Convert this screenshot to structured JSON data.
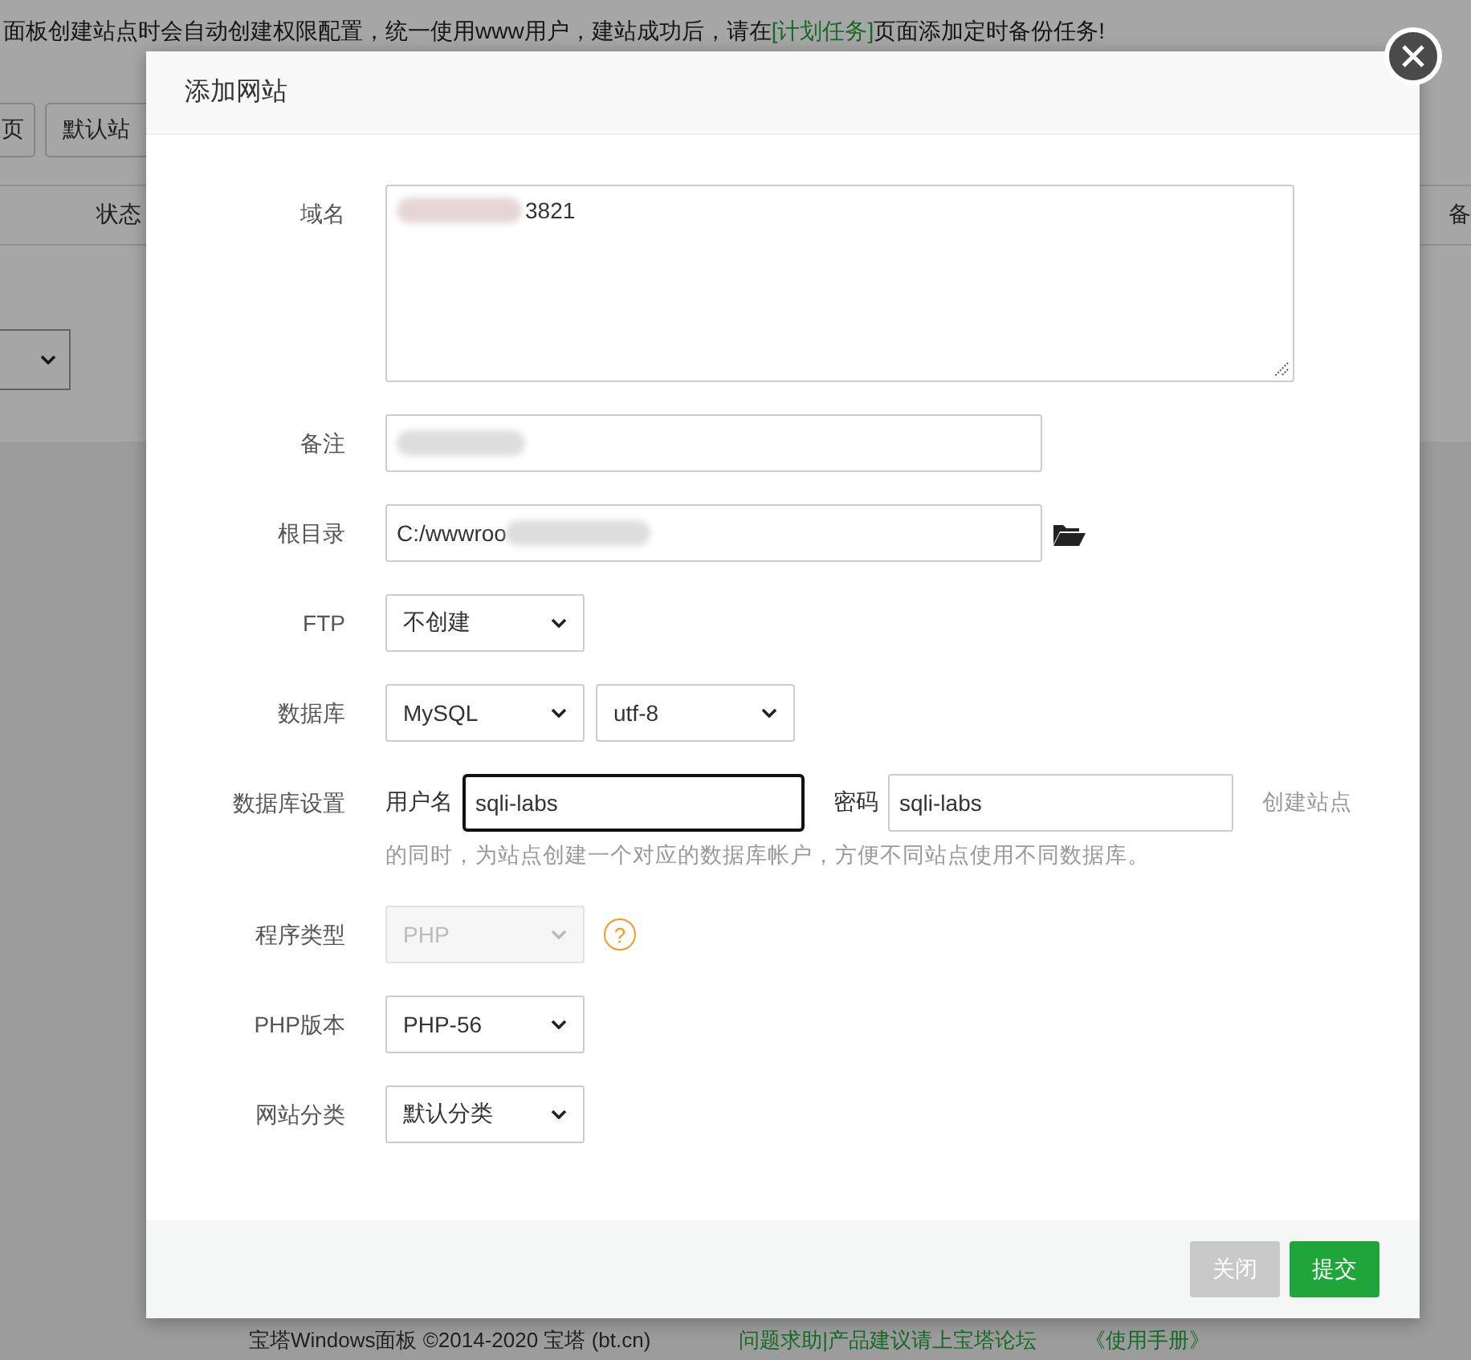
{
  "background": {
    "notice": {
      "text": "面板创建站点时会自动创建权限配置，统一使用www用户，建站成功后，请在",
      "link": "[计划任务]",
      "after": "页面添加定时备份任务!"
    },
    "buttons": [
      "页",
      "默认站"
    ],
    "table_header": [
      "状态",
      "备"
    ],
    "footer": {
      "copyright": "宝塔Windows面板 ©2014-2020 宝塔 (bt.cn)",
      "links": [
        "问题求助|产品建议请上宝塔论坛",
        "《使用手册》"
      ]
    }
  },
  "dialog": {
    "title": "添加网站",
    "fields": [
      {
        "kind": "textarea",
        "label": "域名",
        "value": "3821",
        "redacted": true
      },
      {
        "kind": "input",
        "label": "备注",
        "redacted": true
      },
      {
        "kind": "path",
        "label": "根目录",
        "value": "C:/wwwroo",
        "redacted": true
      },
      {
        "kind": "select",
        "label": "FTP",
        "selects": [
          {
            "value": "不创建",
            "disabled": false
          }
        ]
      },
      {
        "kind": "select",
        "label": "数据库",
        "selects": [
          {
            "value": "MySQL",
            "disabled": false
          },
          {
            "value": "utf-8",
            "disabled": false
          }
        ]
      },
      {
        "kind": "db",
        "label": "数据库设置",
        "user_label": "用户名",
        "user": "sqli-labs",
        "user_focused": true,
        "pass_label": "密码",
        "password": "sqli-labs",
        "hint_lines": [
          "创建站点",
          "的同时，为站点创建一个对应的数据库帐户，方便不同站点使用不同数据库。"
        ]
      },
      {
        "kind": "select",
        "label": "程序类型",
        "selects": [
          {
            "value": "PHP",
            "disabled": true
          }
        ],
        "help": "?"
      },
      {
        "kind": "select",
        "label": "PHP版本",
        "selects": [
          {
            "value": "PHP-56",
            "disabled": false
          }
        ]
      },
      {
        "kind": "select",
        "label": "网站分类",
        "selects": [
          {
            "value": "默认分类",
            "disabled": false
          }
        ]
      }
    ],
    "buttons": [
      {
        "label": "关闭",
        "kind": "secondary"
      },
      {
        "label": "提交",
        "kind": "primary"
      }
    ]
  }
}
